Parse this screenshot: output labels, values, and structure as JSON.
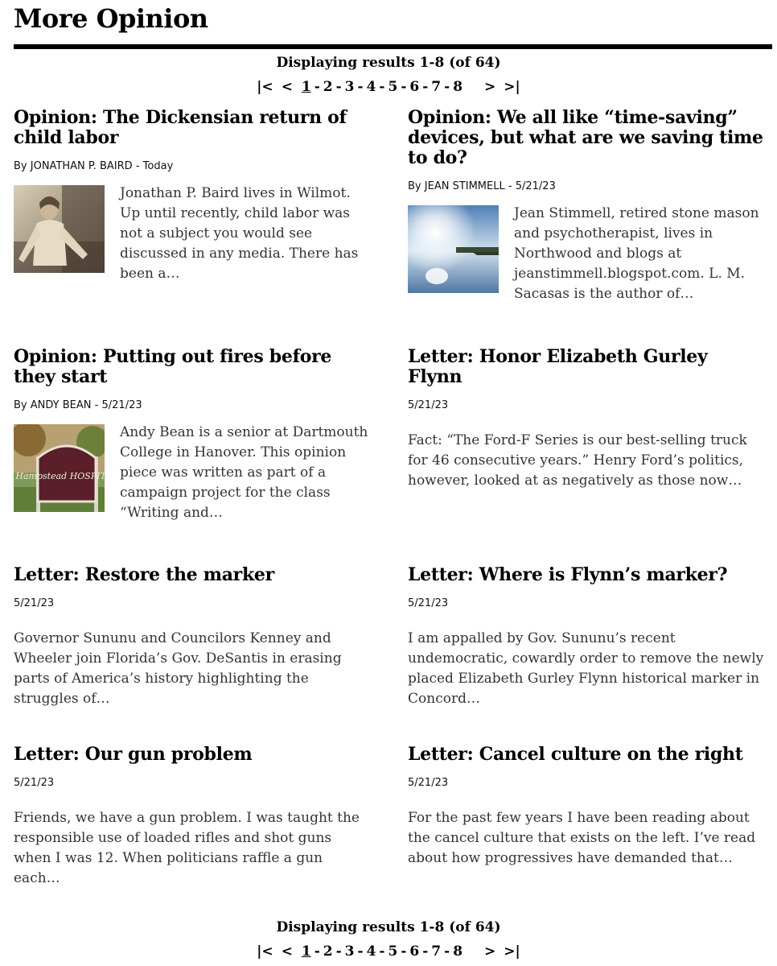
{
  "section": {
    "title": "More Opinion"
  },
  "results": {
    "text": "Displaying results 1-8 (of 64)"
  },
  "pager": {
    "first": "|<",
    "prev": "<",
    "pages": [
      "1",
      "2",
      "3",
      "4",
      "5",
      "6",
      "7",
      "8"
    ],
    "next": ">",
    "last": ">|",
    "separator": "-"
  },
  "articles": [
    {
      "headline": "Opinion: The Dickensian return of child labor",
      "by": "By",
      "author": "JONATHAN P. BAIRD",
      "dash": "-",
      "date": "Today",
      "summary": "Jonathan P. Baird lives in Wilmot. Up until recently, child labor was not a subject you would see discussed in any media. There has been a…"
    },
    {
      "headline": "Opinion: We all like “time-saving” devices, but what are we saving time to do?",
      "by": "By",
      "author": "JEAN STIMMELL",
      "dash": "-",
      "date": "5/21/23",
      "summary": "Jean Stimmell, retired stone mason and psychotherapist, lives in Northwood and blogs at jeanstimmell.blogspot.com. L. M. Sacasas is the author of…"
    },
    {
      "headline": "Opinion: Putting out fires before they start",
      "by": "By",
      "author": "ANDY BEAN",
      "dash": "-",
      "date": "5/21/23",
      "summary": "Andy Bean is a senior at Dartmouth College in Hanover. This opinion piece was written as part of a campaign project for the class “Writing and…",
      "sign_text": "Hampstead HOSPITAL"
    },
    {
      "headline": "Letter: Honor Elizabeth Gurley Flynn",
      "date": "5/21/23",
      "summary": "Fact: “The Ford-F Series is our best-selling truck for 46 consecutive years.” Henry Ford’s politics, however, looked at as negatively as those now…"
    },
    {
      "headline": "Letter: Restore the marker",
      "date": "5/21/23",
      "summary": "Governor Sununu and Councilors Kenney and Wheeler join Florida’s Gov. DeSantis in erasing parts of America’s history highlighting the struggles of…"
    },
    {
      "headline": "Letter: Where is Flynn’s marker?",
      "date": "5/21/23",
      "summary": "I am appalled by Gov. Sununu’s recent undemocratic, cowardly order to remove the newly placed Elizabeth Gurley Flynn historical marker in Concord…"
    },
    {
      "headline": "Letter: Our gun problem",
      "date": "5/21/23",
      "summary": "Friends, we have a gun problem. I was taught the responsible use of loaded rifles and shot guns when I was 12. When politicians raffle a gun each…"
    },
    {
      "headline": "Letter: Cancel culture on the right",
      "date": "5/21/23",
      "summary": "For the past few years I have been reading about the cancel culture that exists on the left. I’ve read about how progressives have demanded that…"
    }
  ]
}
